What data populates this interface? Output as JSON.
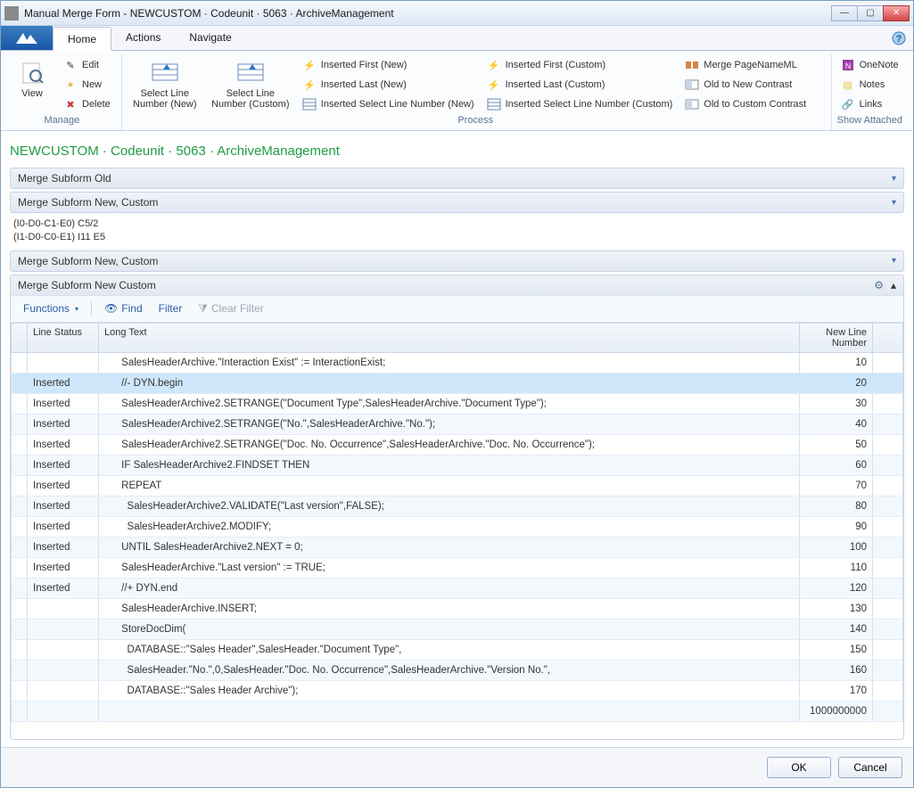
{
  "window": {
    "title": "Manual Merge Form - NEWCUSTOM · Codeunit · 5063 · ArchiveManagement"
  },
  "tabs": {
    "home": "Home",
    "actions": "Actions",
    "navigate": "Navigate"
  },
  "ribbon": {
    "manage": {
      "title": "Manage",
      "view": "View",
      "edit": "Edit",
      "new": "New",
      "delete": "Delete"
    },
    "process": {
      "title": "Process",
      "select_line_new": "Select Line\nNumber (New)",
      "select_line_custom": "Select Line\nNumber (Custom)",
      "inserted_first_new": "Inserted First (New)",
      "inserted_last_new": "Inserted Last (New)",
      "inserted_select_new": "Inserted Select Line Number (New)",
      "inserted_first_custom": "Inserted First (Custom)",
      "inserted_last_custom": "Inserted Last (Custom)",
      "inserted_select_custom": "Inserted Select Line Number (Custom)",
      "merge_pagenameml": "Merge PageNameML",
      "old_to_new": "Old to New Contrast",
      "old_to_custom": "Old to Custom Contrast"
    },
    "show_attached": {
      "title": "Show Attached",
      "onenote": "OneNote",
      "notes": "Notes",
      "links": "Links"
    }
  },
  "breadcrumb": "NEWCUSTOM · Codeunit · 5063 · ArchiveManagement",
  "panels": {
    "old": "Merge Subform Old",
    "new_custom": "Merge Subform New, Custom",
    "new_custom2": "Merge Subform New, Custom",
    "new_custom_panel": "Merge Subform New Custom"
  },
  "info_lines": [
    "(I0-D0-C1-E0) C5/2",
    "(I1-D0-C0-E1) I11 E5"
  ],
  "toolbar": {
    "functions": "Functions",
    "find": "Find",
    "filter": "Filter",
    "clear": "Clear Filter"
  },
  "grid": {
    "headers": {
      "status": "Line Status",
      "text": "Long Text",
      "num": "New Line\nNumber"
    },
    "rows": [
      {
        "status": "",
        "text": "      SalesHeaderArchive.\"Interaction Exist\" := InteractionExist;",
        "num": "10",
        "sel": false
      },
      {
        "status": "Inserted",
        "text": "      //- DYN.begin",
        "num": "20",
        "sel": true
      },
      {
        "status": "Inserted",
        "text": "      SalesHeaderArchive2.SETRANGE(\"Document Type\",SalesHeaderArchive.\"Document Type\");",
        "num": "30",
        "sel": false
      },
      {
        "status": "Inserted",
        "text": "      SalesHeaderArchive2.SETRANGE(\"No.\",SalesHeaderArchive.\"No.\");",
        "num": "40",
        "sel": false
      },
      {
        "status": "Inserted",
        "text": "      SalesHeaderArchive2.SETRANGE(\"Doc. No. Occurrence\",SalesHeaderArchive.\"Doc. No. Occurrence\");",
        "num": "50",
        "sel": false
      },
      {
        "status": "Inserted",
        "text": "      IF SalesHeaderArchive2.FINDSET THEN",
        "num": "60",
        "sel": false
      },
      {
        "status": "Inserted",
        "text": "      REPEAT",
        "num": "70",
        "sel": false
      },
      {
        "status": "Inserted",
        "text": "        SalesHeaderArchive2.VALIDATE(\"Last version\",FALSE);",
        "num": "80",
        "sel": false
      },
      {
        "status": "Inserted",
        "text": "        SalesHeaderArchive2.MODIFY;",
        "num": "90",
        "sel": false
      },
      {
        "status": "Inserted",
        "text": "      UNTIL SalesHeaderArchive2.NEXT = 0;",
        "num": "100",
        "sel": false
      },
      {
        "status": "Inserted",
        "text": "      SalesHeaderArchive.\"Last version\" := TRUE;",
        "num": "110",
        "sel": false
      },
      {
        "status": "Inserted",
        "text": "      //+ DYN.end",
        "num": "120",
        "sel": false
      },
      {
        "status": "",
        "text": "      SalesHeaderArchive.INSERT;",
        "num": "130",
        "sel": false
      },
      {
        "status": "",
        "text": "      StoreDocDim(",
        "num": "140",
        "sel": false
      },
      {
        "status": "",
        "text": "        DATABASE::\"Sales Header\",SalesHeader.\"Document Type\",",
        "num": "150",
        "sel": false
      },
      {
        "status": "",
        "text": "        SalesHeader.\"No.\",0,SalesHeader.\"Doc. No. Occurrence\",SalesHeaderArchive.\"Version No.\",",
        "num": "160",
        "sel": false
      },
      {
        "status": "",
        "text": "        DATABASE::\"Sales Header Archive\");",
        "num": "170",
        "sel": false
      },
      {
        "status": "",
        "text": "",
        "num": "1000000000",
        "sel": false
      }
    ]
  },
  "footer": {
    "ok": "OK",
    "cancel": "Cancel"
  }
}
